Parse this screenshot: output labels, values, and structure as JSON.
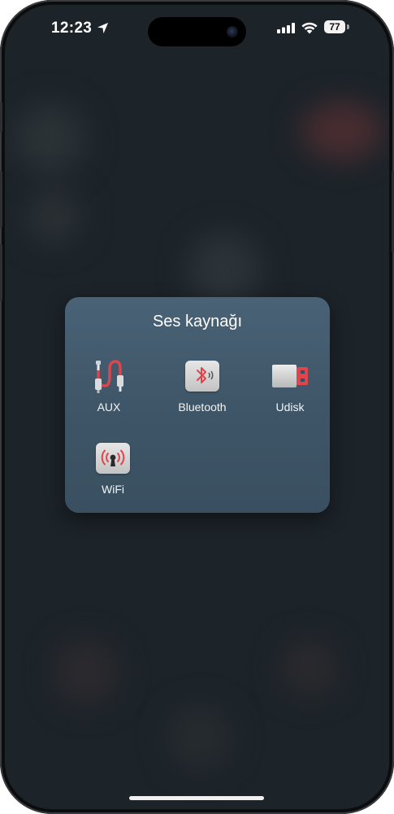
{
  "status_bar": {
    "time": "12:23",
    "battery": "77",
    "icons": [
      "location-arrow-icon",
      "cellular-signal-icon",
      "wifi-icon",
      "battery-icon"
    ]
  },
  "popup": {
    "title": "Ses kaynağı",
    "sources": [
      {
        "label": "AUX",
        "icon": "aux-cable-icon"
      },
      {
        "label": "Bluetooth",
        "icon": "bluetooth-icon"
      },
      {
        "label": "Udisk",
        "icon": "usb-drive-icon"
      },
      {
        "label": "WiFi",
        "icon": "wifi-broadcast-icon"
      }
    ]
  },
  "colors": {
    "accent_red": "#e0454e",
    "popup_bg": "#3f5669",
    "screen_bg": "#1c2329"
  }
}
